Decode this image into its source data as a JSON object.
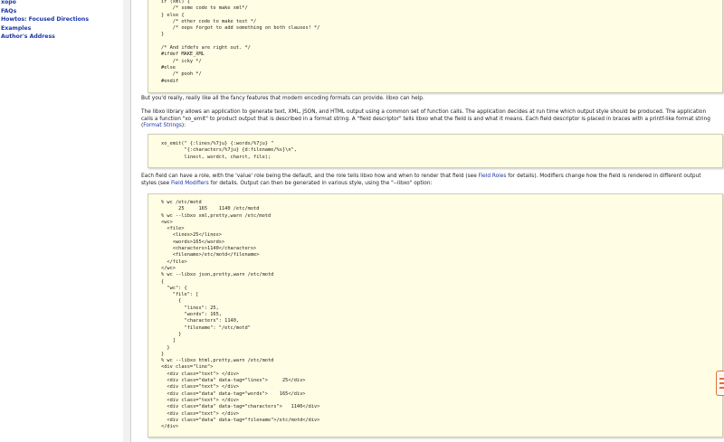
{
  "sidebar": {
    "items": [
      "xopo",
      "FAQs",
      "Howtos: Focused Directions",
      "Examples",
      "Author's Address"
    ]
  },
  "code1": "if (xml) {\n    /* some code to make xml*/\n} else {\n    /* other code to make text */\n    /* oops forgot to add something on both clauses! */\n}\n\n/* And ifdefs are right out. */\n#ifdef MAKE_XML\n    /* icky */\n#else\n    /* pooh */\n#endif",
  "para1": "But you'd really, really like all the fancy features that modern encoding formats can provide. libxo can help.",
  "para2": "The libxo library allows an application to generate text, XML, JSON, and HTML output using a common set of function calls. The application decides at run time which output style should be produced. The application calls a function \"xo_emit\" to product output that is described in a format string. A \"field descriptor\" tells libxo what the field is and what it means. Each field descriptor is placed in braces with a printf-like format string (",
  "para2_link": "Format Strings",
  "para2_end": "):",
  "code2": "xo_emit(\" {:lines/%7ju} {:words/%7ju} \"\n        \"{:characters/%7ju} {d:filename/%s}\\n\",\n        linect, wordct, charct, file);",
  "para3_a": "Each field can have a role, with the 'value' role being the default, and the role tells libxo how and when to render that field (see ",
  "para3_link1": "Field Roles",
  "para3_b": " for details). Modifiers change how the field is rendered in different output styles (see ",
  "para3_link2": "Field Modifiers",
  "para3_c": " for details. Output can then be generated in various style, using the \"--libxo\" option:",
  "code3": "% wc /etc/motd\n      25     165    1140 /etc/motd\n% wc --libxo xml,pretty,warn /etc/motd\n<wc>\n  <file>\n    <lines>25</lines>\n    <words>165</words>\n    <characters>1140</characters>\n    <filename>/etc/motd</filename>\n  </file>\n</wc>\n% wc --libxo json,pretty,warn /etc/motd\n{\n  \"wc\": {\n    \"file\": [\n      {\n        \"lines\": 25,\n        \"words\": 165,\n        \"characters\": 1140,\n        \"filename\": \"/etc/motd\"\n      }\n    ]\n  }\n}\n% wc --libxo html,pretty,warn /etc/motd\n<div class=\"line\">\n  <div class=\"text\"> </div>\n  <div class=\"data\" data-tag=\"lines\">     25</div>\n  <div class=\"text\"> </div>\n  <div class=\"data\" data-tag=\"words\">    165</div>\n  <div class=\"text\"> </div>\n  <div class=\"data\" data-tag=\"characters\">   1140</div>\n  <div class=\"text\"> </div>\n  <div class=\"data\" data-tag=\"filename\">/etc/motd</div>\n</div>"
}
